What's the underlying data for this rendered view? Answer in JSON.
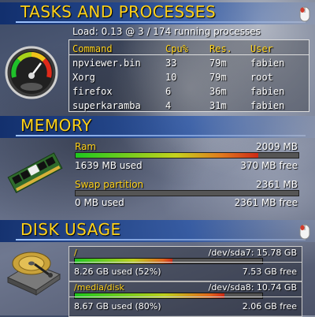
{
  "tasks": {
    "title": "TASKS AND PROCESSES",
    "load_line": "Load: 0.13 @ 3 / 174 running processes",
    "columns": [
      "Command",
      "Cpu%",
      "Res.",
      "User"
    ],
    "rows": [
      [
        "npviewer.bin",
        "33",
        "79m",
        "fabien"
      ],
      [
        "Xorg",
        "10",
        "79m",
        "root"
      ],
      [
        "firefox",
        "6",
        "36m",
        "fabien"
      ],
      [
        "superkaramba",
        "4",
        "31m",
        "fabien"
      ]
    ]
  },
  "memory": {
    "title": "MEMORY",
    "ram": {
      "label": "Ram",
      "total": "2009 MB",
      "used": "1639 MB used",
      "free": "370 MB free",
      "fraction": 0.82
    },
    "swap": {
      "label": "Swap partition",
      "total": "2361 MB",
      "used": "0 MB used",
      "free": "2361 MB free",
      "fraction": 0.0
    }
  },
  "disk": {
    "title": "DISK USAGE",
    "items": [
      {
        "mount": "/",
        "device": "/dev/sda7: 15.78 GB",
        "used": "8.26 GB used (52%)",
        "free": "7.53 GB free",
        "fraction": 0.52
      },
      {
        "mount": "/media/disk",
        "device": "/dev/sda8: 10.74 GB",
        "used": "8.67 GB used (80%)",
        "free": "2.06 GB free",
        "fraction": 0.8
      }
    ]
  },
  "colors": {
    "accent": "#ffd21a",
    "header_blue": "#1a3f8f"
  },
  "icons": [
    "gauge-icon",
    "mouse-icon",
    "ram-stick-icon",
    "hard-drive-icon"
  ]
}
